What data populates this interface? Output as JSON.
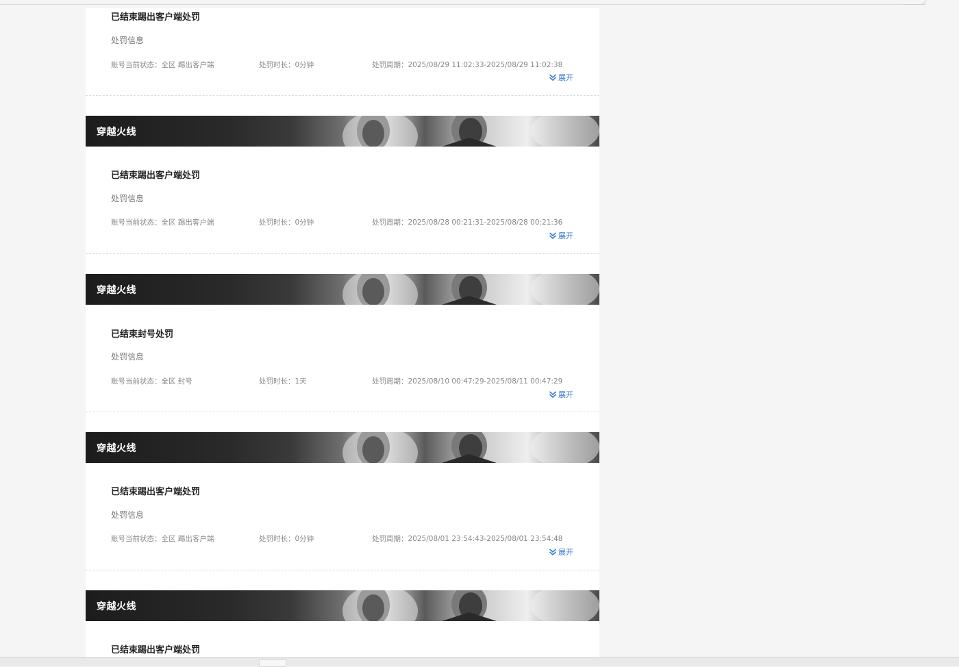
{
  "labels": {
    "info": "处罚信息",
    "status_prefix": "账号当前状态：",
    "duration_prefix": "处罚时长：",
    "period_prefix": "处罚周期：",
    "expand": "展开"
  },
  "banner_title": "穿越火线",
  "records": [
    {
      "title": "已结束踢出客户端处罚",
      "status": "全区 踢出客户端",
      "duration": "0分钟",
      "period": "2025/08/29 11:02:33-2025/08/29 11:02:38"
    },
    {
      "title": "已结束踢出客户端处罚",
      "status": "全区 踢出客户端",
      "duration": "0分钟",
      "period": "2025/08/28 00:21:31-2025/08/28 00:21:36"
    },
    {
      "title": "已结束封号处罚",
      "status": "全区 封号",
      "duration": "1天",
      "period": "2025/08/10 00:47:29-2025/08/11 00:47:29"
    },
    {
      "title": "已结束踢出客户端处罚",
      "status": "全区 踢出客户端",
      "duration": "0分钟",
      "period": "2025/08/01 23:54:43-2025/08/01 23:54:48"
    },
    {
      "title": "已结束踢出客户端处罚"
    }
  ],
  "colors": {
    "accent": "#3a7bd5",
    "title": "#222222",
    "muted": "#888888",
    "page_bg": "#f5f5f5"
  },
  "icons": {
    "expand": "double-chevron-down-icon"
  }
}
